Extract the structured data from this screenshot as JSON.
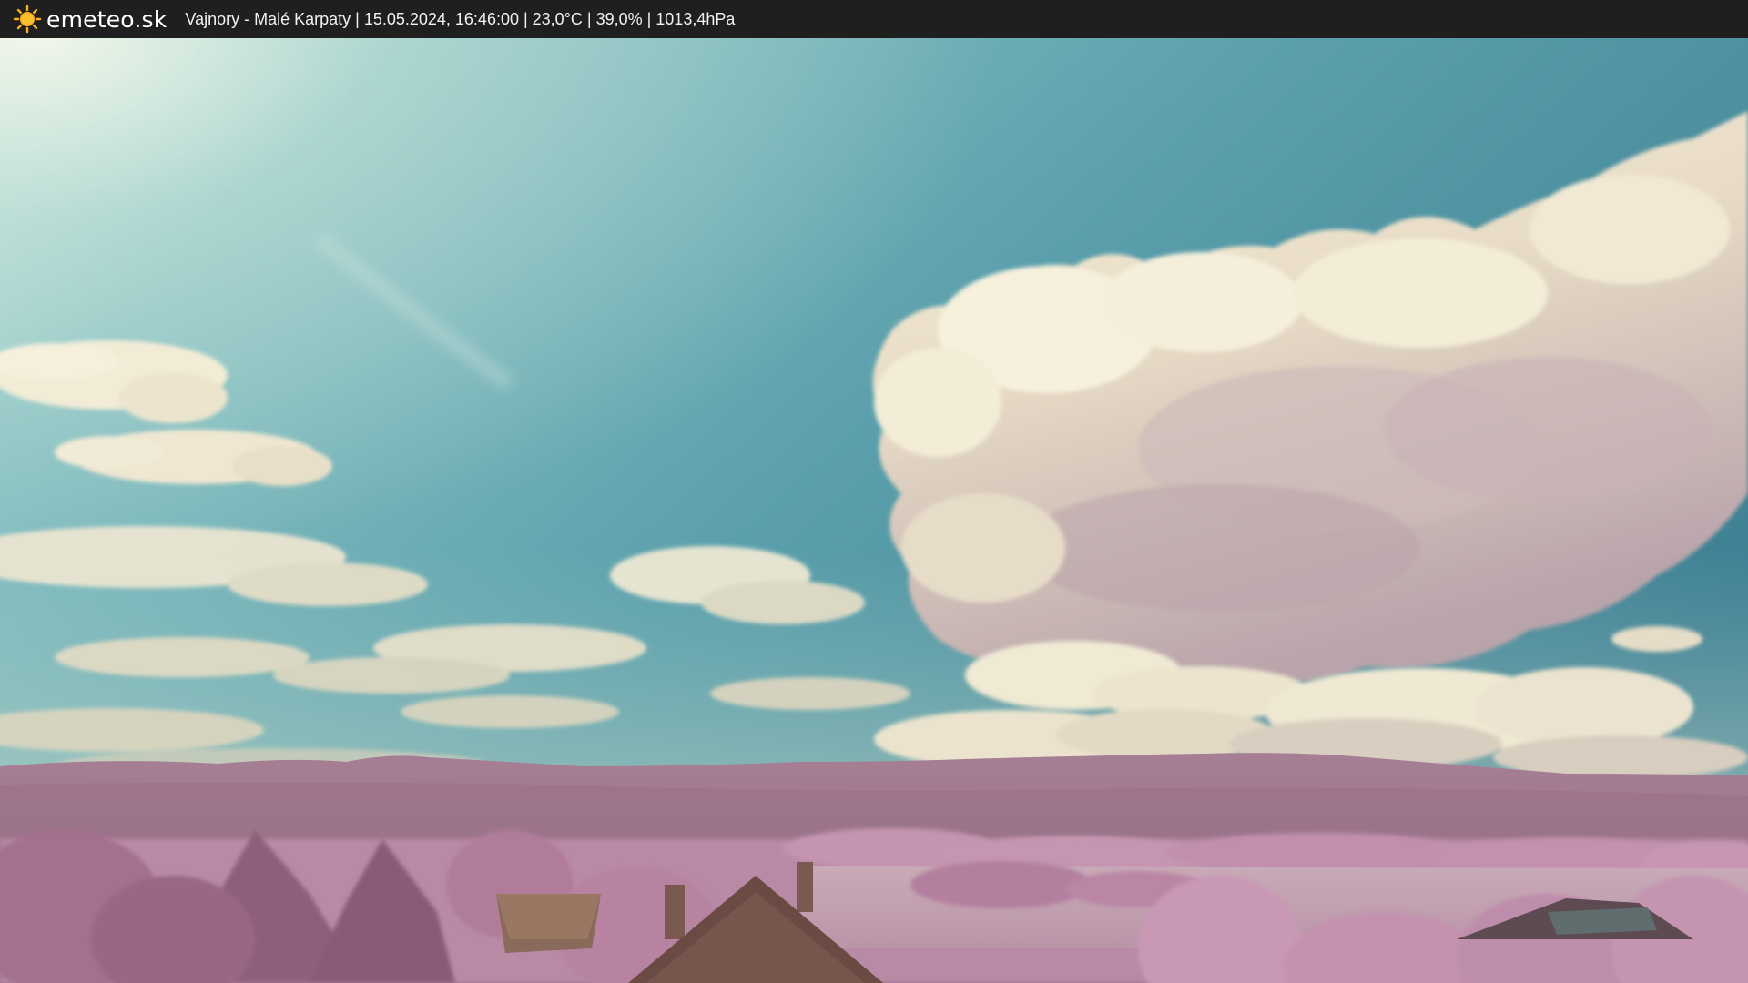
{
  "header": {
    "brand": "emeteo.sk",
    "caption": "Vajnory - Malé Karpaty | 15.05.2024, 16:46:00 | 23,0°C | 39,0% | 1013,4hPa",
    "logo_icon": "sun-icon"
  },
  "colors": {
    "bar_background": "#1f1f1f",
    "sky_light": "#a9d3d2",
    "sky_mid": "#5fa5ad",
    "sky_dark": "#3d7f93",
    "cloud_light": "#f3ecd6",
    "cloud_shadow": "#b7a3a8",
    "hills": "#a37a93",
    "foliage": "#c592b0",
    "roof": "#6b4a44"
  }
}
